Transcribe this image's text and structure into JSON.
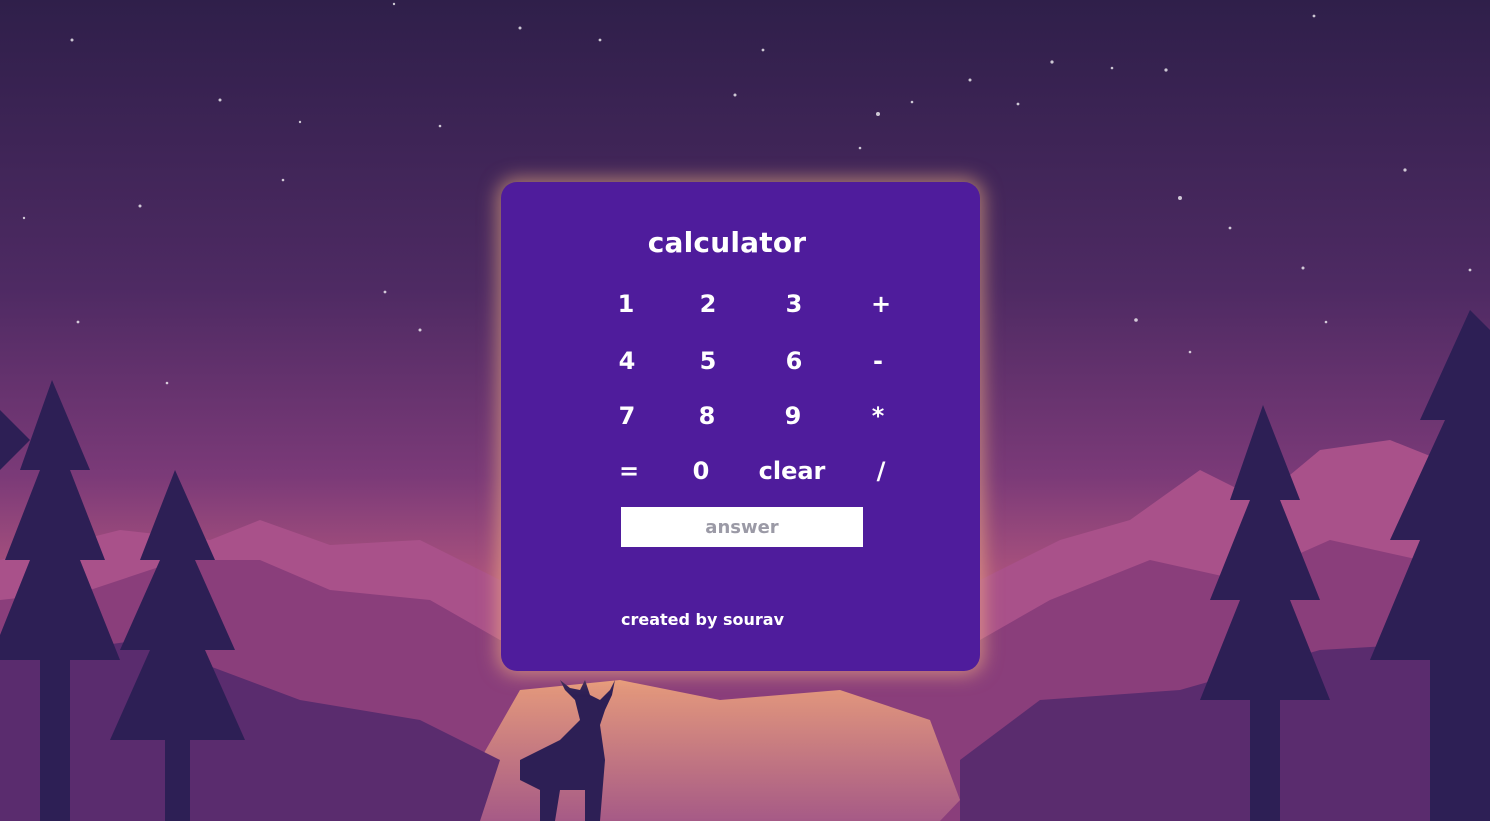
{
  "app": {
    "title": "calculator"
  },
  "keypad": {
    "rows": [
      [
        "1",
        "2",
        "3",
        "+"
      ],
      [
        "4",
        "5",
        "6",
        "-"
      ],
      [
        "7",
        "8",
        "9",
        "*"
      ],
      [
        "=",
        "0",
        "clear",
        "/"
      ]
    ]
  },
  "answer": {
    "value": "",
    "placeholder": "answer"
  },
  "footer": {
    "credit": "created by sourav"
  },
  "colors": {
    "card": "#4f1c9c",
    "sky_top": "#2f1f4a",
    "sky_mid": "#7b3a78",
    "horizon_glow": "#f2a36a",
    "tree_silhouette": "#2d1f55",
    "text": "#ffffff"
  }
}
